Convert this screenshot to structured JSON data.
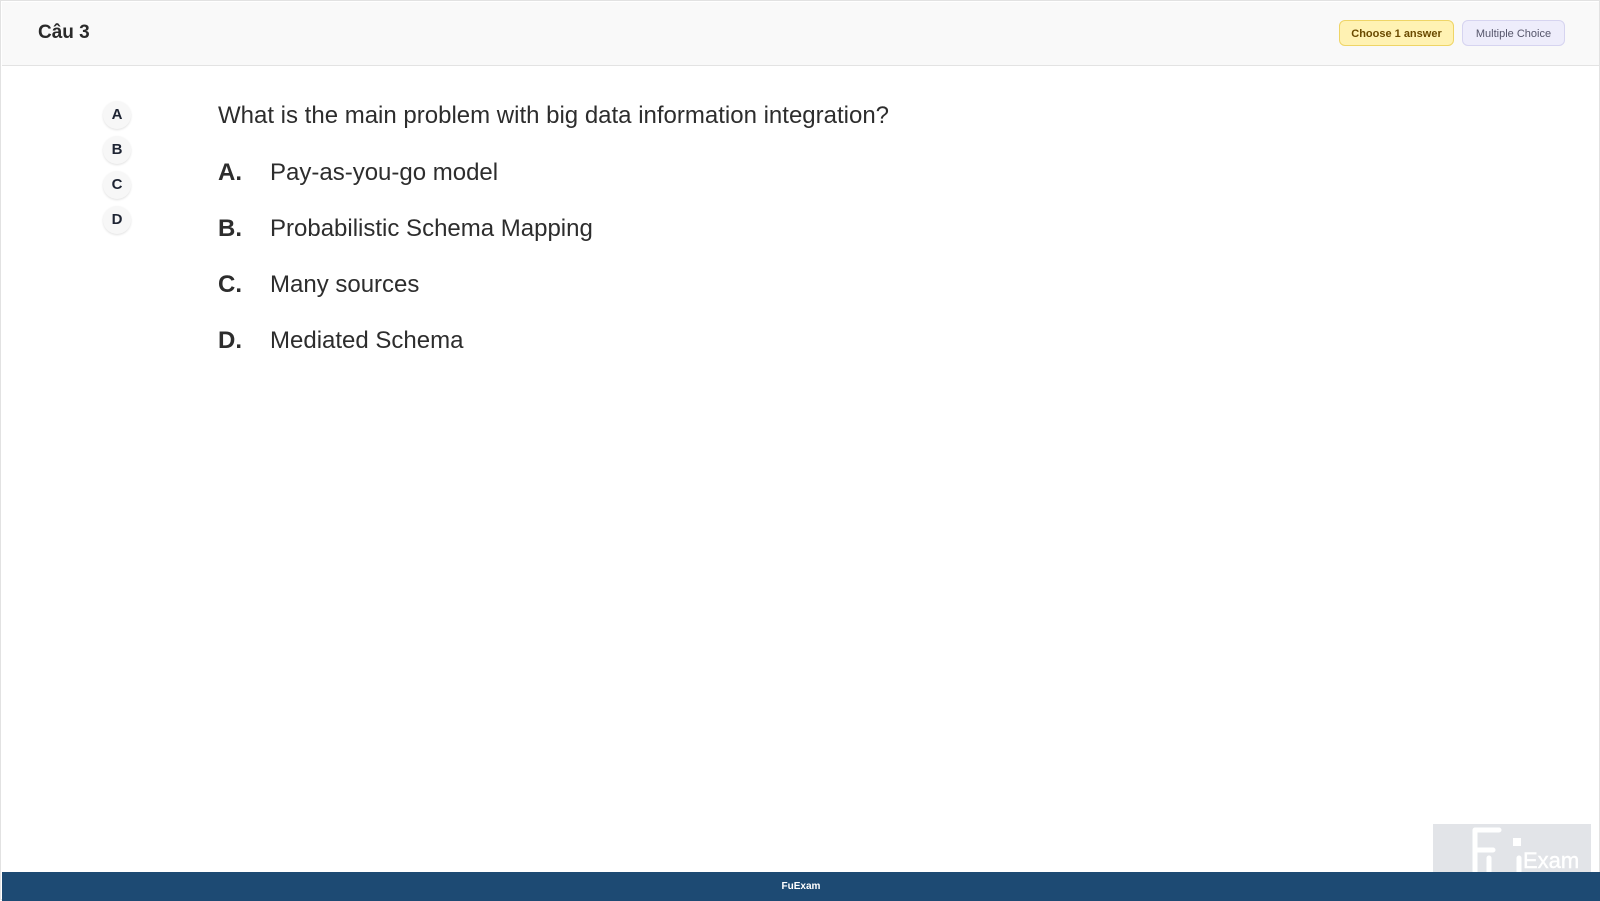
{
  "header": {
    "title": "Câu 3",
    "badge_choose": "Choose 1 answer",
    "badge_type": "Multiple Choice"
  },
  "answer_nav": [
    "A",
    "B",
    "C",
    "D"
  ],
  "question": {
    "text": "What is the main problem with big data information integration?",
    "options": [
      {
        "key": "A.",
        "text": "Pay-as-you-go model"
      },
      {
        "key": "B.",
        "text": "Probabilistic Schema Mapping"
      },
      {
        "key": "C.",
        "text": "Many sources"
      },
      {
        "key": "D.",
        "text": "Mediated Schema"
      }
    ]
  },
  "footer": {
    "label": "FuExam"
  },
  "watermark": {
    "logo_text": "FU",
    "logo_subtext": "Exam"
  }
}
